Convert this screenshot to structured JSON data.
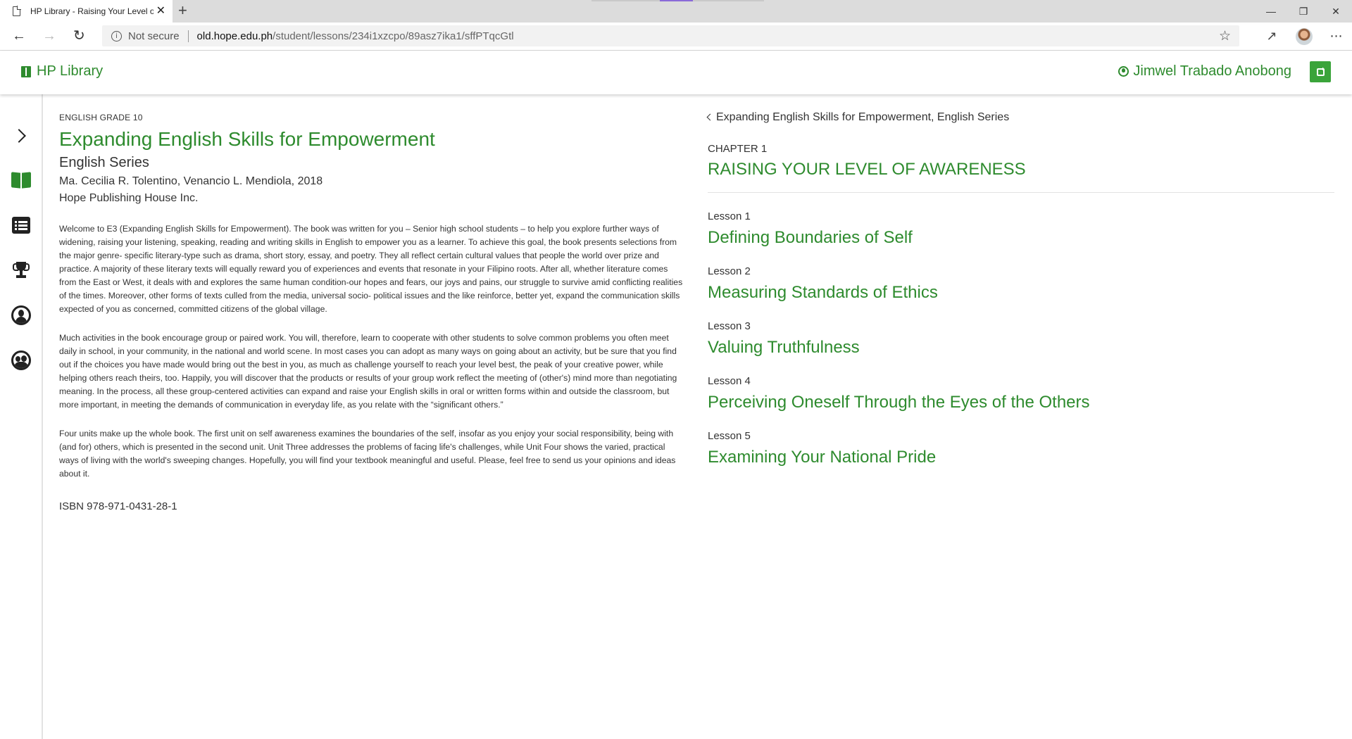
{
  "browser": {
    "tab_title": "HP Library - Raising Your Level o",
    "tab_close": "✕",
    "new_tab": "+",
    "security_label": "Not secure",
    "url_host": "old.hope.edu.ph",
    "url_path": "/student/lessons/234i1xzcpo/89asz7ika1/sffPTqcGtl",
    "window_controls": [
      "—",
      "❐",
      "✕"
    ]
  },
  "header": {
    "brand": "HP Library",
    "user_name": "Jimwel Trabado Anobong"
  },
  "sidebar": {
    "items": [
      {
        "icon": "chevron-right-icon"
      },
      {
        "icon": "book-icon"
      },
      {
        "icon": "list-icon"
      },
      {
        "icon": "trophy-icon"
      },
      {
        "icon": "user-circle-icon"
      },
      {
        "icon": "group-circle-icon"
      }
    ]
  },
  "book": {
    "grade": "ENGLISH GRADE 10",
    "title": "Expanding English Skills for Empowerment",
    "series": "English Series",
    "authors": "Ma. Cecilia R. Tolentino, Venancio L. Mendiola, 2018",
    "publisher": "Hope Publishing House Inc.",
    "paragraphs": [
      "Welcome to E3 (Expanding English Skills for Empowerment). The book was written for you – Senior high school students – to help you explore further ways of widening, raising your listening, speaking, reading and writing skills in English to empower you as a learner. To achieve this goal, the book presents selections from the major genre- specific literary-type such as drama, short story, essay, and poetry. They all reflect certain cultural values that people the world over prize and practice. A majority of these literary texts will equally reward you of experiences and events that resonate in your Filipino roots. After all, whether literature comes from the East or West, it deals with and explores the same human condition-our hopes and fears, our joys and pains, our struggle to survive amid conflicting realities of the times. Moreover, other forms of texts culled from the media, universal socio- political issues and the like reinforce, better yet, expand the communication skills expected of you as concerned, committed citizens of the global village.",
      "Much activities in the book encourage group or paired work. You will, therefore, learn to cooperate with other students to solve common problems you often meet daily in school, in your community, in the national and world scene. In most cases you can adopt as many ways on going about an activity, but be sure that you find out if the choices you have made would bring out the best in you, as much as challenge yourself to reach your level best, the peak of your creative power, while helping others reach theirs, too. Happily, you will discover that the products or results of your group work reflect the meeting of (other's) mind more than negotiating meaning. In the process, all these group-centered activities can expand and raise your English skills in oral or written forms within and outside the classroom, but more important, in meeting the demands of communication in everyday life, as you relate with the “significant others.”",
      "Four units make up the whole book. The first unit on self awareness examines the boundaries of the self, insofar as you enjoy your social responsibility, being with (and for) others, which is presented in the second unit. Unit Three addresses the problems of facing life's challenges, while Unit Four shows the varied, practical ways of living with the world's sweeping changes. Hopefully, you will find your textbook meaningful and useful. Please, feel free to send us your opinions and ideas about it."
    ],
    "isbn": "ISBN 978-971-0431-28-1"
  },
  "chapter": {
    "back_link": "Expanding English Skills for Empowerment, English Series",
    "label": "CHAPTER 1",
    "title": "RAISING YOUR LEVEL OF AWARENESS",
    "lessons": [
      {
        "label": "Lesson 1",
        "title": "Defining Boundaries of Self"
      },
      {
        "label": "Lesson 2",
        "title": "Measuring Standards of Ethics"
      },
      {
        "label": "Lesson 3",
        "title": "Valuing Truthfulness"
      },
      {
        "label": "Lesson 4",
        "title": "Perceiving Oneself Through the Eyes of the Others"
      },
      {
        "label": "Lesson 5",
        "title": "Examining Your National Pride"
      }
    ]
  },
  "colors": {
    "accent_green": "#2e8b2e",
    "button_green": "#3aa43a",
    "text": "#333333"
  }
}
